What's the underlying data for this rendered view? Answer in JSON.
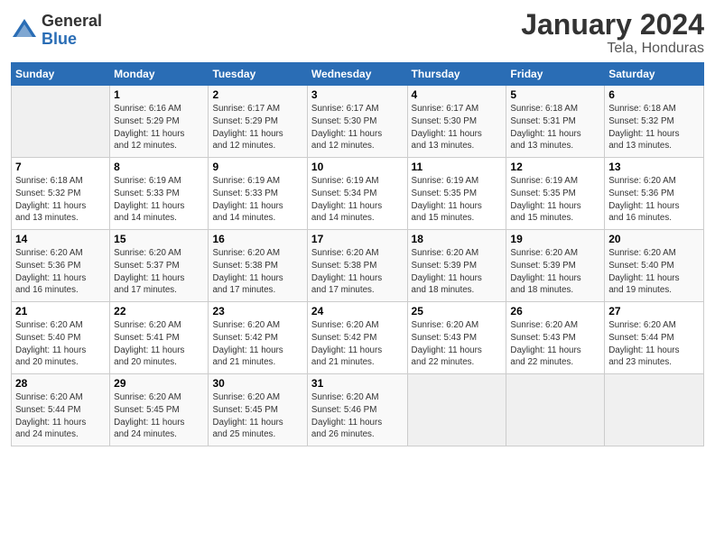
{
  "logo": {
    "general": "General",
    "blue": "Blue"
  },
  "title": "January 2024",
  "location": "Tela, Honduras",
  "days_header": [
    "Sunday",
    "Monday",
    "Tuesday",
    "Wednesday",
    "Thursday",
    "Friday",
    "Saturday"
  ],
  "weeks": [
    [
      {
        "num": "",
        "info": ""
      },
      {
        "num": "1",
        "info": "Sunrise: 6:16 AM\nSunset: 5:29 PM\nDaylight: 11 hours\nand 12 minutes."
      },
      {
        "num": "2",
        "info": "Sunrise: 6:17 AM\nSunset: 5:29 PM\nDaylight: 11 hours\nand 12 minutes."
      },
      {
        "num": "3",
        "info": "Sunrise: 6:17 AM\nSunset: 5:30 PM\nDaylight: 11 hours\nand 12 minutes."
      },
      {
        "num": "4",
        "info": "Sunrise: 6:17 AM\nSunset: 5:30 PM\nDaylight: 11 hours\nand 13 minutes."
      },
      {
        "num": "5",
        "info": "Sunrise: 6:18 AM\nSunset: 5:31 PM\nDaylight: 11 hours\nand 13 minutes."
      },
      {
        "num": "6",
        "info": "Sunrise: 6:18 AM\nSunset: 5:32 PM\nDaylight: 11 hours\nand 13 minutes."
      }
    ],
    [
      {
        "num": "7",
        "info": "Sunrise: 6:18 AM\nSunset: 5:32 PM\nDaylight: 11 hours\nand 13 minutes."
      },
      {
        "num": "8",
        "info": "Sunrise: 6:19 AM\nSunset: 5:33 PM\nDaylight: 11 hours\nand 14 minutes."
      },
      {
        "num": "9",
        "info": "Sunrise: 6:19 AM\nSunset: 5:33 PM\nDaylight: 11 hours\nand 14 minutes."
      },
      {
        "num": "10",
        "info": "Sunrise: 6:19 AM\nSunset: 5:34 PM\nDaylight: 11 hours\nand 14 minutes."
      },
      {
        "num": "11",
        "info": "Sunrise: 6:19 AM\nSunset: 5:35 PM\nDaylight: 11 hours\nand 15 minutes."
      },
      {
        "num": "12",
        "info": "Sunrise: 6:19 AM\nSunset: 5:35 PM\nDaylight: 11 hours\nand 15 minutes."
      },
      {
        "num": "13",
        "info": "Sunrise: 6:20 AM\nSunset: 5:36 PM\nDaylight: 11 hours\nand 16 minutes."
      }
    ],
    [
      {
        "num": "14",
        "info": "Sunrise: 6:20 AM\nSunset: 5:36 PM\nDaylight: 11 hours\nand 16 minutes."
      },
      {
        "num": "15",
        "info": "Sunrise: 6:20 AM\nSunset: 5:37 PM\nDaylight: 11 hours\nand 17 minutes."
      },
      {
        "num": "16",
        "info": "Sunrise: 6:20 AM\nSunset: 5:38 PM\nDaylight: 11 hours\nand 17 minutes."
      },
      {
        "num": "17",
        "info": "Sunrise: 6:20 AM\nSunset: 5:38 PM\nDaylight: 11 hours\nand 17 minutes."
      },
      {
        "num": "18",
        "info": "Sunrise: 6:20 AM\nSunset: 5:39 PM\nDaylight: 11 hours\nand 18 minutes."
      },
      {
        "num": "19",
        "info": "Sunrise: 6:20 AM\nSunset: 5:39 PM\nDaylight: 11 hours\nand 18 minutes."
      },
      {
        "num": "20",
        "info": "Sunrise: 6:20 AM\nSunset: 5:40 PM\nDaylight: 11 hours\nand 19 minutes."
      }
    ],
    [
      {
        "num": "21",
        "info": "Sunrise: 6:20 AM\nSunset: 5:40 PM\nDaylight: 11 hours\nand 20 minutes."
      },
      {
        "num": "22",
        "info": "Sunrise: 6:20 AM\nSunset: 5:41 PM\nDaylight: 11 hours\nand 20 minutes."
      },
      {
        "num": "23",
        "info": "Sunrise: 6:20 AM\nSunset: 5:42 PM\nDaylight: 11 hours\nand 21 minutes."
      },
      {
        "num": "24",
        "info": "Sunrise: 6:20 AM\nSunset: 5:42 PM\nDaylight: 11 hours\nand 21 minutes."
      },
      {
        "num": "25",
        "info": "Sunrise: 6:20 AM\nSunset: 5:43 PM\nDaylight: 11 hours\nand 22 minutes."
      },
      {
        "num": "26",
        "info": "Sunrise: 6:20 AM\nSunset: 5:43 PM\nDaylight: 11 hours\nand 22 minutes."
      },
      {
        "num": "27",
        "info": "Sunrise: 6:20 AM\nSunset: 5:44 PM\nDaylight: 11 hours\nand 23 minutes."
      }
    ],
    [
      {
        "num": "28",
        "info": "Sunrise: 6:20 AM\nSunset: 5:44 PM\nDaylight: 11 hours\nand 24 minutes."
      },
      {
        "num": "29",
        "info": "Sunrise: 6:20 AM\nSunset: 5:45 PM\nDaylight: 11 hours\nand 24 minutes."
      },
      {
        "num": "30",
        "info": "Sunrise: 6:20 AM\nSunset: 5:45 PM\nDaylight: 11 hours\nand 25 minutes."
      },
      {
        "num": "31",
        "info": "Sunrise: 6:20 AM\nSunset: 5:46 PM\nDaylight: 11 hours\nand 26 minutes."
      },
      {
        "num": "",
        "info": ""
      },
      {
        "num": "",
        "info": ""
      },
      {
        "num": "",
        "info": ""
      }
    ]
  ]
}
